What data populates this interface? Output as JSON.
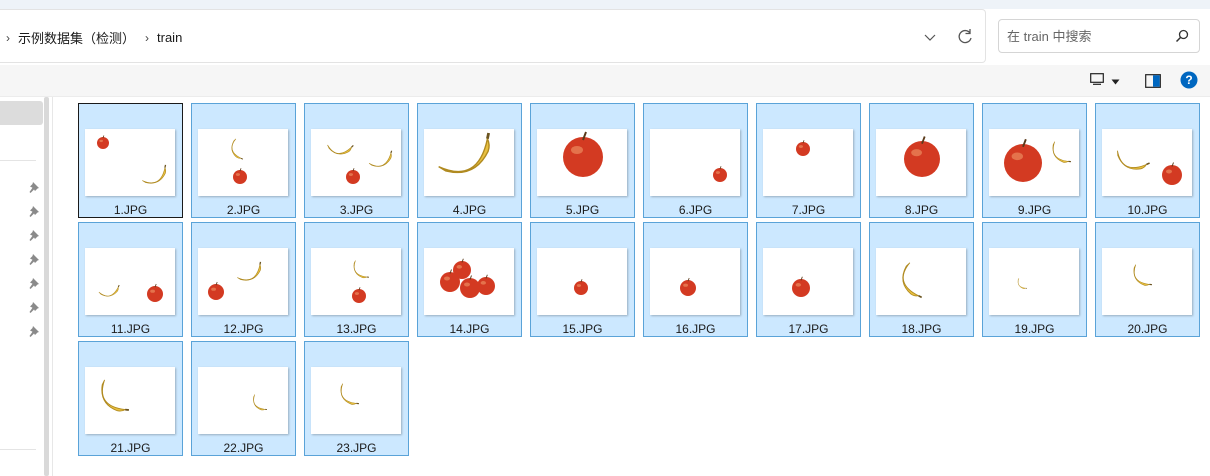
{
  "address_bar": {
    "breadcrumbs": [
      "示例数据集（检测）",
      "train"
    ],
    "dropdown_icon": "chevron-down-icon",
    "refresh_icon": "refresh-icon"
  },
  "search": {
    "placeholder": "在 train 中搜索",
    "icon": "search-icon"
  },
  "toolbar": {
    "view_icon": "view-layout-icon",
    "preview_icon": "preview-pane-icon",
    "help_icon": "help-icon",
    "help_label": "?"
  },
  "nav_pane": {
    "pin_count": 7,
    "pin_icon": "pin-icon"
  },
  "colors": {
    "selection_fill": "#cce8ff",
    "selection_border": "#5aa3d8",
    "apple": "#d33a22",
    "banana": "#e8c040",
    "accent": "#0067c0"
  },
  "files": [
    {
      "name": "1.JPG",
      "thumbnail": [
        "apple",
        "banana"
      ],
      "selected": true,
      "focused": true
    },
    {
      "name": "2.JPG",
      "thumbnail": [
        "banana",
        "apple"
      ],
      "selected": true
    },
    {
      "name": "3.JPG",
      "thumbnail": [
        "banana",
        "apple",
        "banana"
      ],
      "selected": true
    },
    {
      "name": "4.JPG",
      "thumbnail": [
        "banana"
      ],
      "selected": true
    },
    {
      "name": "5.JPG",
      "thumbnail": [
        "apple"
      ],
      "selected": true
    },
    {
      "name": "6.JPG",
      "thumbnail": [
        "apple"
      ],
      "selected": true
    },
    {
      "name": "7.JPG",
      "thumbnail": [
        "apple"
      ],
      "selected": true
    },
    {
      "name": "8.JPG",
      "thumbnail": [
        "apple"
      ],
      "selected": true
    },
    {
      "name": "9.JPG",
      "thumbnail": [
        "apple",
        "banana"
      ],
      "selected": true
    },
    {
      "name": "10.JPG",
      "thumbnail": [
        "banana",
        "apple"
      ],
      "selected": true
    },
    {
      "name": "11.JPG",
      "thumbnail": [
        "banana",
        "apple"
      ],
      "selected": true
    },
    {
      "name": "12.JPG",
      "thumbnail": [
        "apple",
        "banana"
      ],
      "selected": true
    },
    {
      "name": "13.JPG",
      "thumbnail": [
        "banana",
        "apple"
      ],
      "selected": true
    },
    {
      "name": "14.JPG",
      "thumbnail": [
        "apple",
        "apple",
        "apple",
        "apple"
      ],
      "selected": true
    },
    {
      "name": "15.JPG",
      "thumbnail": [
        "apple"
      ],
      "selected": true
    },
    {
      "name": "16.JPG",
      "thumbnail": [
        "apple"
      ],
      "selected": true
    },
    {
      "name": "17.JPG",
      "thumbnail": [
        "apple"
      ],
      "selected": true
    },
    {
      "name": "18.JPG",
      "thumbnail": [
        "banana"
      ],
      "selected": true
    },
    {
      "name": "19.JPG",
      "thumbnail": [
        "banana"
      ],
      "selected": true
    },
    {
      "name": "20.JPG",
      "thumbnail": [
        "banana"
      ],
      "selected": true
    },
    {
      "name": "21.JPG",
      "thumbnail": [
        "banana"
      ],
      "selected": true
    },
    {
      "name": "22.JPG",
      "thumbnail": [
        "banana"
      ],
      "selected": true
    },
    {
      "name": "23.JPG",
      "thumbnail": [
        "banana"
      ],
      "selected": true
    }
  ]
}
